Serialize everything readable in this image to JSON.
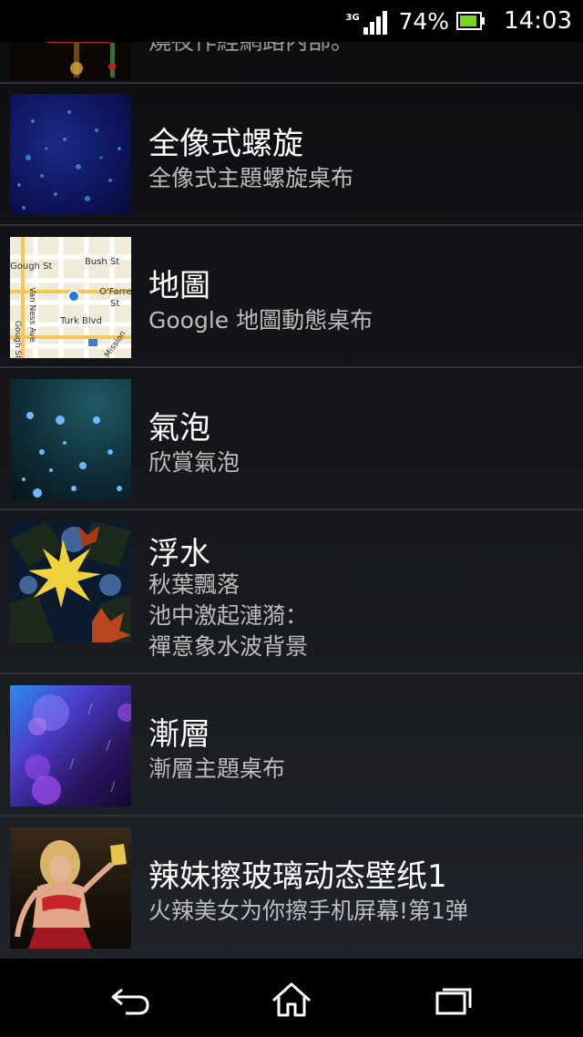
{
  "status_bar": {
    "network_type": "3G",
    "battery_percent": "74%",
    "battery_level": 0.74,
    "time": "14:03"
  },
  "wallpapers": [
    {
      "title": "",
      "description": "燒夜作經網路內部。"
    },
    {
      "title": "全像式螺旋",
      "description": "全像式主題螺旋桌布"
    },
    {
      "title": "地圖",
      "description": "Google 地圖動態桌布",
      "map_labels": [
        "Van Ness Ave",
        "Bush St",
        "O'Farrell",
        "St",
        "Gough St",
        "Turk Blvd",
        "Mission"
      ]
    },
    {
      "title": "氣泡",
      "description": "欣賞氣泡"
    },
    {
      "title": "浮水",
      "description_lines": [
        "秋葉飄落",
        "池中激起漣漪：",
        "禪意象水波背景"
      ]
    },
    {
      "title": "漸層",
      "description": "漸層主題桌布"
    },
    {
      "title": "辣妹擦玻璃动态壁纸1",
      "description": "火辣美女为你擦手机屏幕!第1弹"
    }
  ],
  "nav_bar": {
    "back_icon": "back-arrow-icon",
    "home_icon": "home-icon",
    "recents_icon": "recent-apps-icon"
  }
}
